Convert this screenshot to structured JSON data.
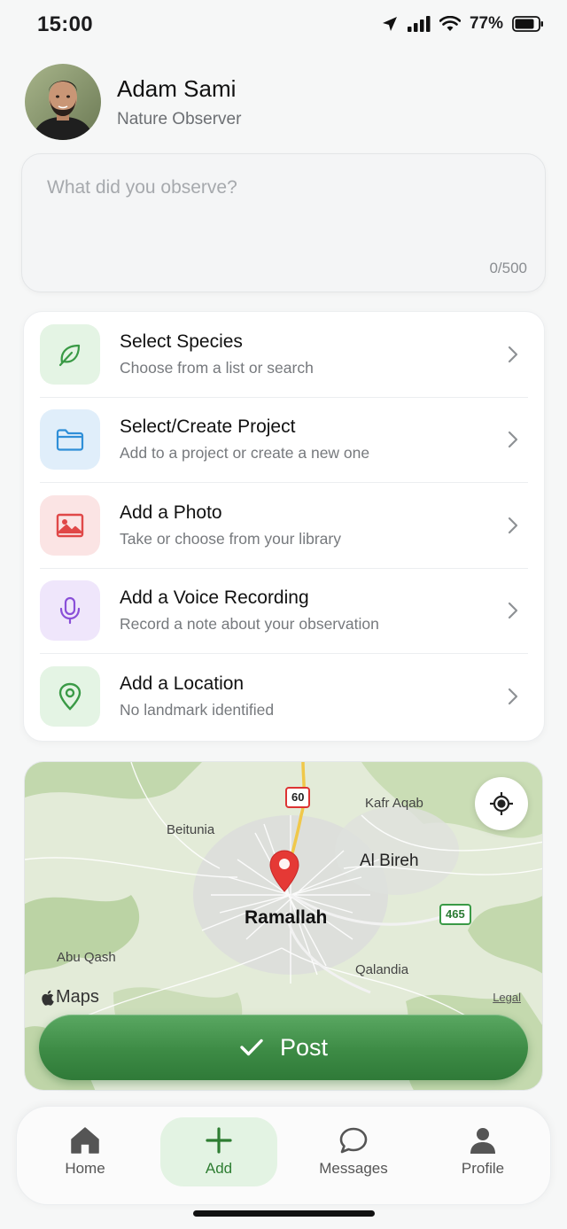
{
  "status_bar": {
    "time": "15:00",
    "battery": "77%"
  },
  "profile": {
    "name": "Adam Sami",
    "role": "Nature Observer"
  },
  "observation": {
    "placeholder": "What did you observe?",
    "counter": "0/500"
  },
  "options": [
    {
      "title": "Select Species",
      "subtitle": "Choose from a list or search",
      "icon": "leaf-icon",
      "bg": "#e4f4e4",
      "color": "#3a9a46"
    },
    {
      "title": "Select/Create Project",
      "subtitle": "Add to a project or create a new one",
      "icon": "folder-icon",
      "bg": "#e0eefa",
      "color": "#2f8fd8"
    },
    {
      "title": "Add a Photo",
      "subtitle": "Take or choose from your library",
      "icon": "image-icon",
      "bg": "#fbe4e4",
      "color": "#e04848"
    },
    {
      "title": "Add a Voice Recording",
      "subtitle": "Record a note about your observation",
      "icon": "microphone-icon",
      "bg": "#efe6fb",
      "color": "#8a4fd8"
    },
    {
      "title": "Add a Location",
      "subtitle": "No landmark identified",
      "icon": "location-pin-icon",
      "bg": "#e4f4e4",
      "color": "#3a9a46"
    }
  ],
  "map": {
    "places": {
      "kafr_aqab": "Kafr Aqab",
      "beitunia": "Beitunia",
      "al_bireh": "Al Bireh",
      "ramallah": "Ramallah",
      "abu_qash": "Abu Qash",
      "qalandia": "Qalandia"
    },
    "road_60": "60",
    "road_465": "465",
    "brand": "Maps",
    "legal": "Legal"
  },
  "post_label": "Post",
  "tabs": [
    {
      "label": "Home",
      "icon": "home-icon"
    },
    {
      "label": "Add",
      "icon": "plus-icon",
      "active": true
    },
    {
      "label": "Messages",
      "icon": "chat-bubble-icon"
    },
    {
      "label": "Profile",
      "icon": "person-icon"
    }
  ],
  "colors": {
    "accent": "#3d8b45",
    "active_tab_bg": "#e3f3e3",
    "pin": "#e53935"
  }
}
